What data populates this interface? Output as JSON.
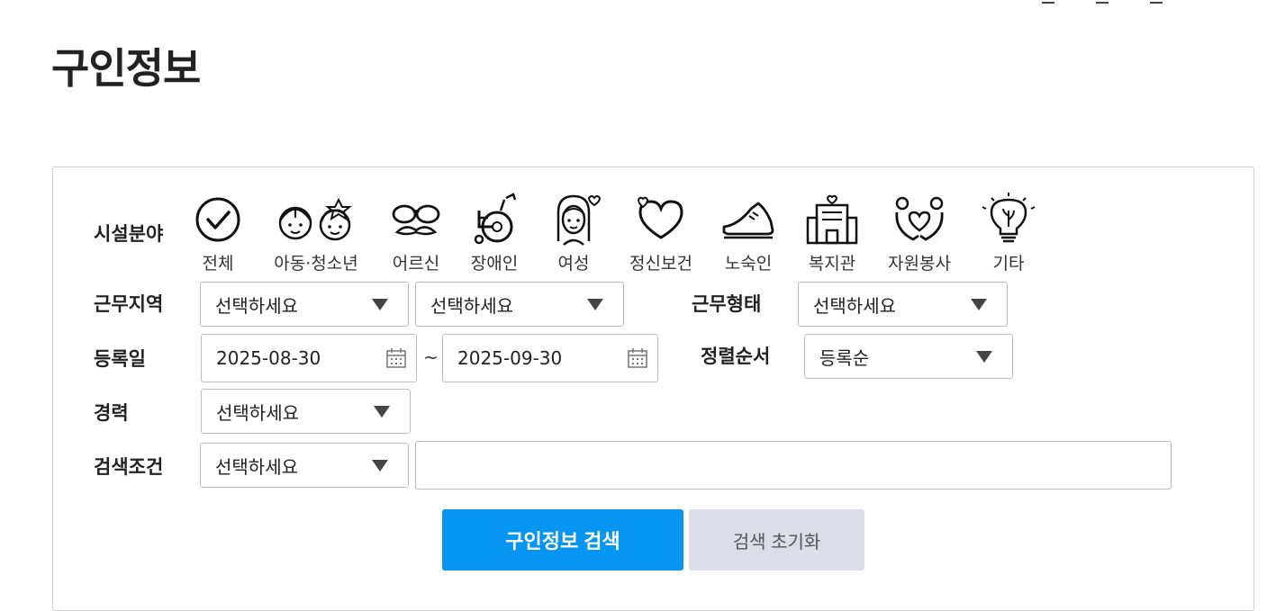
{
  "page": {
    "title": "구인정보"
  },
  "filters": {
    "facility_label": "시설분야",
    "categories": [
      {
        "label": "전체",
        "icon": "check-circle-icon"
      },
      {
        "label": "아동·청소년",
        "icon": "children-icon"
      },
      {
        "label": "어르신",
        "icon": "elderly-glasses-mustache-icon"
      },
      {
        "label": "장애인",
        "icon": "wheelchair-icon"
      },
      {
        "label": "여성",
        "icon": "woman-icon"
      },
      {
        "label": "정신보건",
        "icon": "hearts-icon"
      },
      {
        "label": "노숙인",
        "icon": "shoe-icon"
      },
      {
        "label": "복지관",
        "icon": "building-icon"
      },
      {
        "label": "자원봉사",
        "icon": "volunteer-hands-heart-icon"
      },
      {
        "label": "기타",
        "icon": "lightbulb-icon"
      }
    ],
    "region": {
      "label": "근무지역",
      "select1": "선택하세요",
      "select2": "선택하세요"
    },
    "work_type": {
      "label": "근무형태",
      "value": "선택하세요"
    },
    "reg_date": {
      "label": "등록일",
      "from": "2025-08-30",
      "separator": "~",
      "to": "2025-09-30"
    },
    "sort": {
      "label": "정렬순서",
      "value": "등록순"
    },
    "career": {
      "label": "경력",
      "value": "선택하세요"
    },
    "search_condition": {
      "label": "검색조건",
      "value": "선택하세요",
      "keyword": ""
    }
  },
  "buttons": {
    "search": "구인정보 검색",
    "reset": "검색 초기화"
  }
}
